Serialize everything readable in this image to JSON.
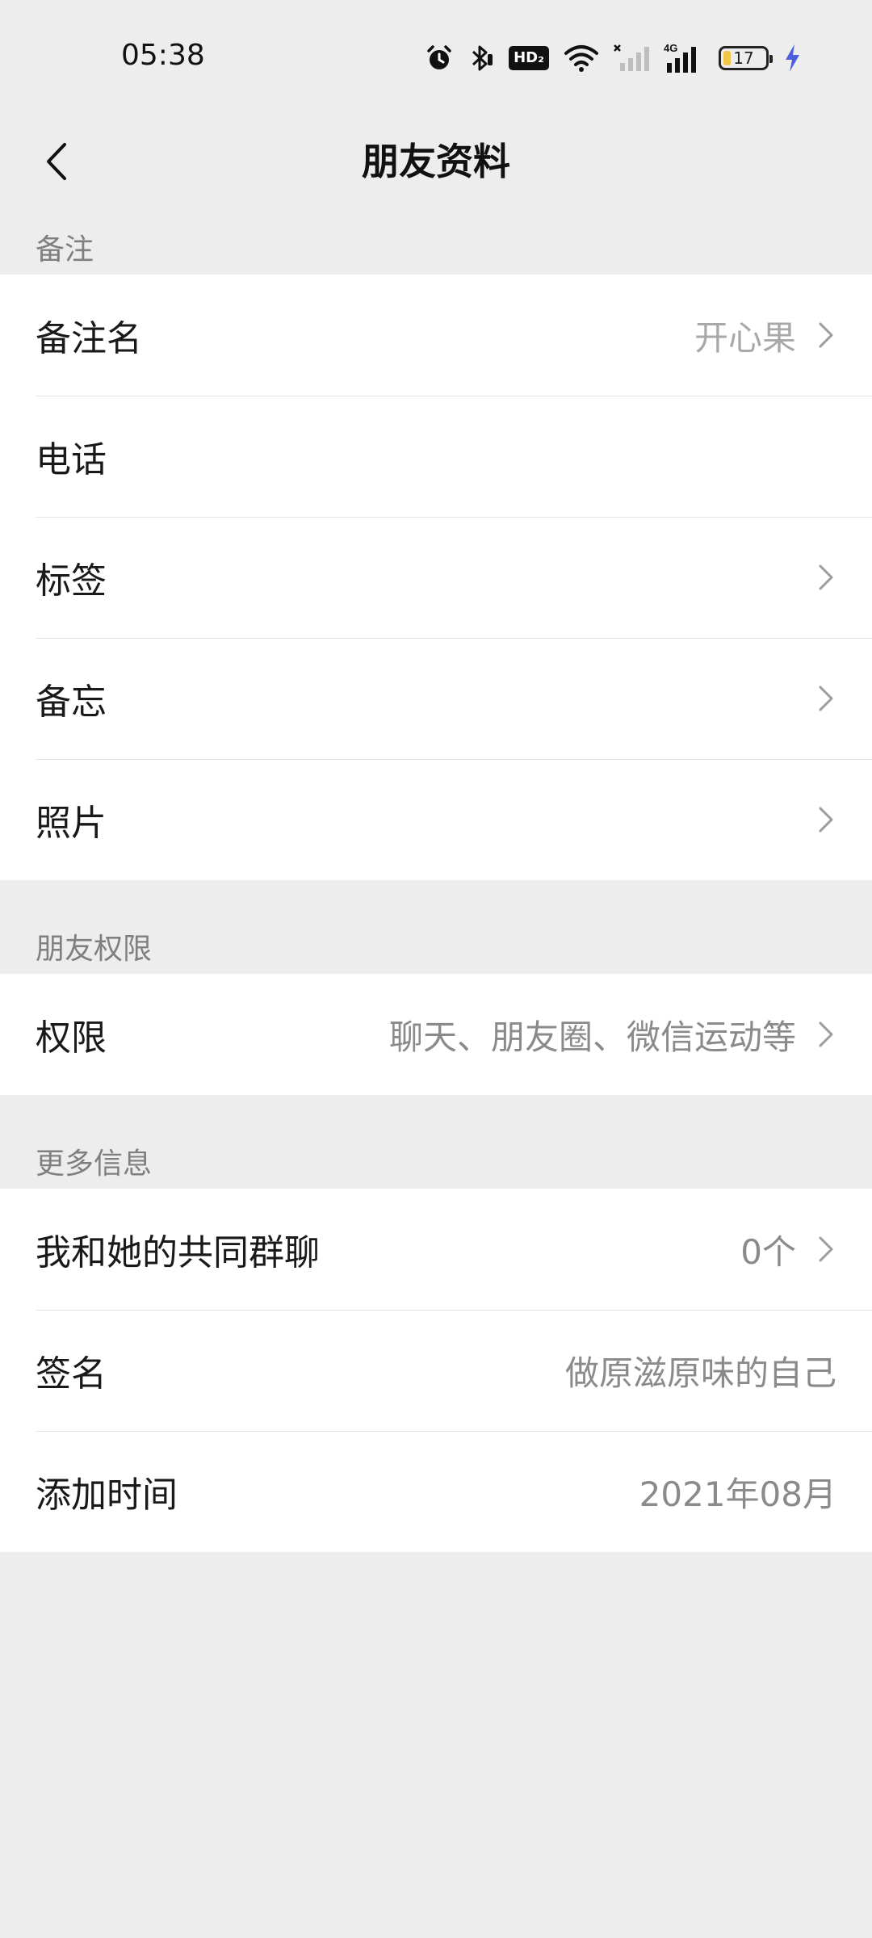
{
  "status_bar": {
    "time": "05:38",
    "hd_label": "HD₂",
    "network": "4G",
    "battery": "17",
    "battery_level_percent": 17,
    "icons": [
      "alarm-icon",
      "bluetooth-icon",
      "hd-icon",
      "wifi-icon",
      "signal-off-icon",
      "signal-4g-icon",
      "battery-icon",
      "charging-icon"
    ]
  },
  "nav": {
    "title": "朋友资料",
    "back_icon": "chevron-left-icon"
  },
  "sections": {
    "remark": {
      "header": "备注",
      "rows": [
        {
          "label": "备注名",
          "value": "开心果"
        },
        {
          "label": "电话",
          "value": ""
        },
        {
          "label": "标签",
          "value": ""
        },
        {
          "label": "备忘",
          "value": ""
        },
        {
          "label": "照片",
          "value": ""
        }
      ]
    },
    "permissions": {
      "header": "朋友权限",
      "rows": [
        {
          "label": "权限",
          "value": "聊天、朋友圈、微信运动等"
        }
      ]
    },
    "more_info": {
      "header": "更多信息",
      "rows": [
        {
          "label": "我和她的共同群聊",
          "value": "0个"
        },
        {
          "label": "签名",
          "value": "做原滋原味的自己"
        },
        {
          "label": "添加时间",
          "value": "2021年08月"
        }
      ]
    }
  },
  "colors": {
    "background": "#ededed",
    "cell_background": "#ffffff",
    "value_text": "#8a8a8a",
    "charging_accent": "#4a5fe0",
    "battery_fill": "#f0c545"
  }
}
